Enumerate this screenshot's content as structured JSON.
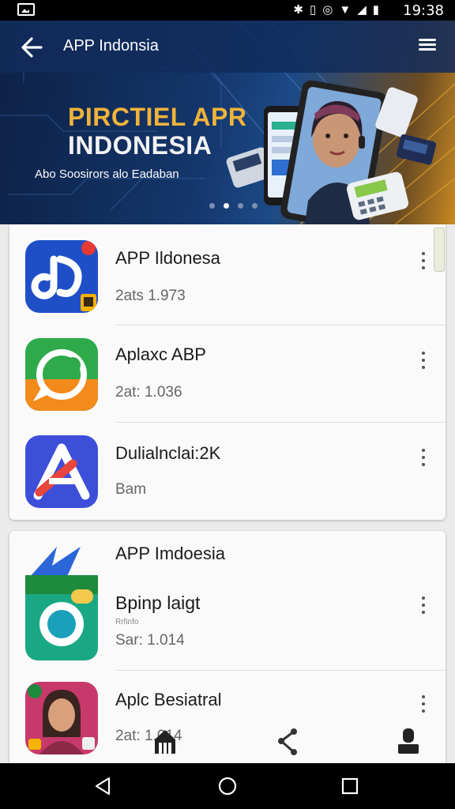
{
  "status_bar": {
    "time": "19:38",
    "icons": [
      "image-icon",
      "bluetooth-icon",
      "vibrate-icon",
      "wifi-icon",
      "signal-icon",
      "battery-icon"
    ]
  },
  "app_bar": {
    "title": "APP Indonsia",
    "back_icon": "back-arrow-icon",
    "menu_icon": "menu-icon"
  },
  "hero": {
    "title_line1": "PIRCTIEL APR",
    "title_line2": "INDONESIA",
    "subtitle": "Abo Soosirors alo Eadaban",
    "carousel_pages": 4,
    "carousel_active_index": 1
  },
  "lists": [
    {
      "items": [
        {
          "title": "APP Ildonesa",
          "subtitle": "2ats 1.973",
          "icon": "music-note-app-icon",
          "color": "#1f4fc7"
        },
        {
          "title": "Aplaxc ABP",
          "subtitle": "2at: 1.036",
          "icon": "chat-bubble-app-icon",
          "color": "#2eaa4a"
        },
        {
          "title": "Dulialnclai:2K",
          "subtitle": "Bam",
          "icon": "letter-a-app-icon",
          "color": "#3d4fd9"
        }
      ]
    },
    {
      "items": [
        {
          "title": "APP Imdoesia",
          "subtitle": "Bpinp laigt",
          "tiny": "Rrfinfo",
          "meta": "Sar: 1.014",
          "icon": "camera-app-icon",
          "color": "#1aa884"
        },
        {
          "title": "Aplc Besiatral",
          "subtitle": "2at: 1.014",
          "icon": "portrait-app-icon",
          "color": "#c8396b"
        }
      ]
    }
  ],
  "bottom_tabs": [
    "home-icon",
    "share-icon",
    "profile-icon"
  ],
  "nav_bar": [
    "back-triangle-icon",
    "home-circle-icon",
    "recents-square-icon"
  ],
  "colors": {
    "app_bar": "#14366b",
    "accent_gold": "#f0b33a",
    "card_bg": "#fafafa",
    "page_bg": "#ebebeb"
  }
}
